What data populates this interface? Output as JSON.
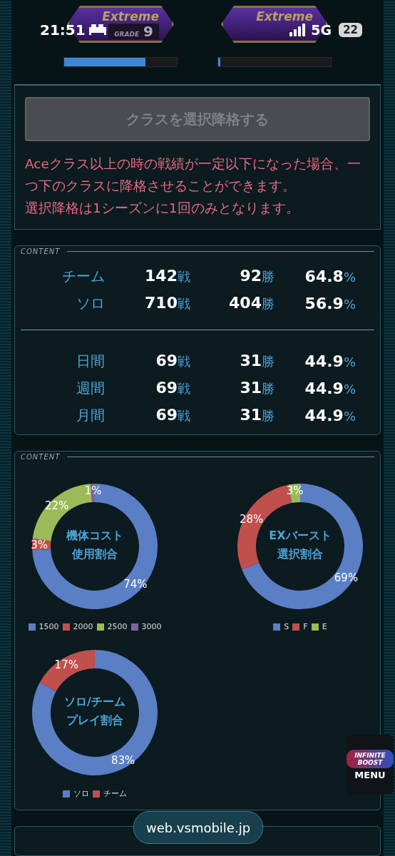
{
  "status_bar": {
    "time": "21:51",
    "network": "5G",
    "battery": "22"
  },
  "rank_badges": [
    {
      "title": "Extreme",
      "grade_label": "GRADE",
      "grade": "9",
      "level": 0.72
    },
    {
      "title": "Extreme",
      "level": 0.02
    }
  ],
  "demotion": {
    "button": {
      "label": "クラスを選択降格する",
      "disabled": true
    },
    "notice": [
      "Aceクラス以上の時の戦績が一定以下になった場合、一つ下のクラスに降格させることができます。",
      "選択降格は1シーズンに1回のみとなります。"
    ]
  },
  "stats": {
    "header": "CONTENT",
    "groups": [
      [
        {
          "label": "チーム",
          "battles": "142",
          "battle_unit": "戦",
          "wins": "92",
          "win_unit": "勝",
          "rate": "64.8",
          "rate_unit": "%"
        },
        {
          "label": "ソロ",
          "battles": "710",
          "battle_unit": "戦",
          "wins": "404",
          "win_unit": "勝",
          "rate": "56.9",
          "rate_unit": "%"
        }
      ],
      [
        {
          "label": "日間",
          "battles": "69",
          "battle_unit": "戦",
          "wins": "31",
          "win_unit": "勝",
          "rate": "44.9",
          "rate_unit": "%"
        },
        {
          "label": "週間",
          "battles": "69",
          "battle_unit": "戦",
          "wins": "31",
          "win_unit": "勝",
          "rate": "44.9",
          "rate_unit": "%"
        },
        {
          "label": "月間",
          "battles": "69",
          "battle_unit": "戦",
          "wins": "31",
          "win_unit": "勝",
          "rate": "44.9",
          "rate_unit": "%"
        }
      ]
    ]
  },
  "ratios": {
    "header": "CONTENT",
    "charts": [
      {
        "center_label": [
          "機体コスト",
          "使用割合"
        ],
        "chart_data": {
          "type": "donut",
          "categories": [
            "1500",
            "2000",
            "2500",
            "3000"
          ],
          "values": [
            74,
            3,
            22,
            1
          ],
          "value_labels": [
            "74%",
            "3%",
            "22%",
            "1%"
          ]
        },
        "legend": [
          {
            "color": "#5b7fc4"
          },
          {
            "color": "#c0504d"
          },
          {
            "color": "#9bbb59"
          },
          {
            "color": "#8064a2"
          }
        ]
      },
      {
        "center_label": [
          "EXバースト",
          "選択割合"
        ],
        "chart_data": {
          "type": "donut",
          "categories": [
            "S",
            "F",
            "E"
          ],
          "values": [
            69,
            28,
            3
          ],
          "value_labels": [
            "69%",
            "28%",
            "3%"
          ]
        },
        "legend": [
          {
            "color": "#5b7fc4"
          },
          {
            "color": "#c0504d"
          },
          {
            "color": "#9bbb59"
          }
        ]
      },
      {
        "center_label": [
          "ソロ/チーム",
          "プレイ割合"
        ],
        "chart_data": {
          "type": "donut",
          "categories": [
            "ソロ",
            "チーム"
          ],
          "values": [
            83,
            17
          ],
          "value_labels": [
            "83%",
            "17%"
          ]
        },
        "legend": [
          {
            "color": "#5b7fc4"
          },
          {
            "color": "#c0504d"
          }
        ]
      }
    ]
  },
  "menu_button": {
    "logo": "INFINITE BOOST",
    "label": "MENU"
  },
  "address_bar": {
    "url": "web.vsmobile.jp"
  }
}
